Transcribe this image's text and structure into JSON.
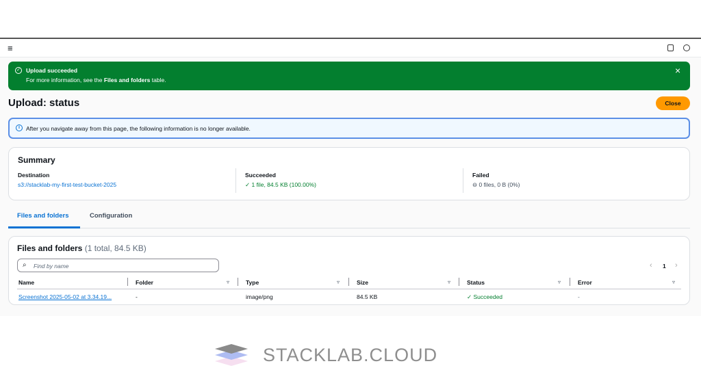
{
  "banner": {
    "title": "Upload succeeded",
    "desc_pre": "For more information, see the ",
    "desc_bold": "Files and folders",
    "desc_post": " table."
  },
  "page": {
    "title": "Upload: status",
    "close_label": "Close"
  },
  "info": {
    "text": "After you navigate away from this page, the following information is no longer available."
  },
  "summary": {
    "title": "Summary",
    "destination_label": "Destination",
    "destination_value": "s3://stacklab-my-first-test-bucket-2025",
    "succeeded_label": "Succeeded",
    "succeeded_value": "1 file, 84.5 KB (100.00%)",
    "failed_label": "Failed",
    "failed_value": "0 files, 0 B (0%)"
  },
  "tabs": [
    {
      "label": "Files and folders",
      "active": true
    },
    {
      "label": "Configuration",
      "active": false
    }
  ],
  "files": {
    "title": "Files and folders",
    "count": "(1 total, 84.5 KB)",
    "search_placeholder": "Find by name",
    "page": "1",
    "columns": [
      "Name",
      "Folder",
      "Type",
      "Size",
      "Status",
      "Error"
    ],
    "rows": [
      {
        "name": "Screenshot 2025-05-02 at 3.34.19...",
        "folder": "-",
        "type": "image/png",
        "size": "84.5 KB",
        "status": "Succeeded",
        "error": "-"
      }
    ]
  },
  "footer": {
    "logo_text": "STACKLAB.CLOUD"
  },
  "colors": {
    "success": "#037f2f",
    "accent": "#0972d3",
    "button": "#ff9900"
  }
}
